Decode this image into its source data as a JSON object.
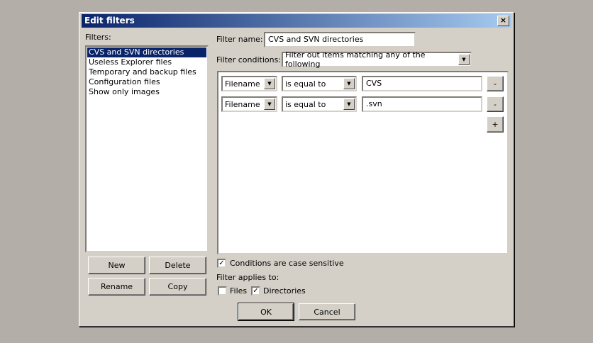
{
  "dialog": {
    "title": "Edit filters",
    "close": "×"
  },
  "filters_label": "Filters:",
  "filters": [
    "CVS and SVN directories",
    "Useless Explorer files",
    "Temporary and backup files",
    "Configuration files",
    "Show only images"
  ],
  "buttons": {
    "new": "New",
    "delete": "Delete",
    "rename": "Rename",
    "copy": "Copy",
    "ok": "OK",
    "cancel": "Cancel",
    "minus": "-",
    "plus": "+"
  },
  "filter_name_label": "Filter name:",
  "filter_name": "CVS and SVN directories",
  "filter_conditions_label": "Filter conditions:",
  "filter_conditions": "Filter out items matching any of the following",
  "conditions": [
    {
      "field": "Filename",
      "op": "is equal to",
      "value": "CVS"
    },
    {
      "field": "Filename",
      "op": "is equal to",
      "value": ".svn"
    }
  ],
  "case_sensitive": {
    "label": "Conditions are case sensitive",
    "checked": true
  },
  "applies_label": "Filter applies to:",
  "files": {
    "label": "Files",
    "checked": false
  },
  "directories": {
    "label": "Directories",
    "checked": true
  }
}
